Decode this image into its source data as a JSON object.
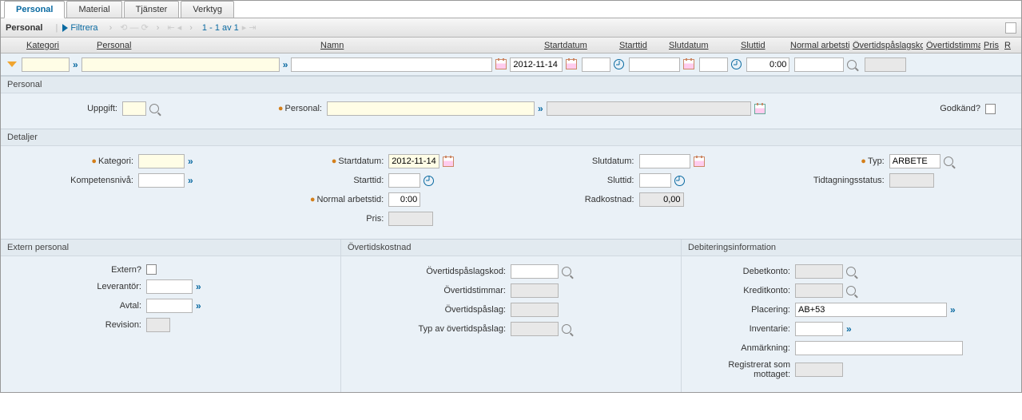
{
  "tabs": [
    "Personal",
    "Material",
    "Tjänster",
    "Verktyg"
  ],
  "toolbar": {
    "title": "Personal",
    "filter": "Filtrera",
    "paging": "1 - 1 av 1"
  },
  "columns": {
    "kategori": "Kategori",
    "personal": "Personal",
    "namn": "Namn",
    "startdatum": "Startdatum",
    "starttid": "Starttid",
    "slutdatum": "Slutdatum",
    "sluttid": "Sluttid",
    "normal": "Normal arbetstid",
    "otkod": "Övertidspåslagskod",
    "ottimmar": "Övertidstimmar",
    "pris": "Pris",
    "r": "R"
  },
  "filter": {
    "startdatum": "2012-11-14",
    "normal": "0:00"
  },
  "sections": {
    "personal": "Personal",
    "detaljer": "Detaljer",
    "extern": "Extern personal",
    "overtid": "Övertidskostnad",
    "debit": "Debiteringsinformation"
  },
  "labels": {
    "uppgift": "Uppgift:",
    "personal": "Personal:",
    "godkand": "Godkänd?",
    "kategori": "Kategori:",
    "kompetens": "Kompetensnivå:",
    "startdatum": "Startdatum:",
    "starttid": "Starttid:",
    "normal": "Normal arbetstid:",
    "pris": "Pris:",
    "slutdatum": "Slutdatum:",
    "sluttid": "Sluttid:",
    "radkostnad": "Radkostnad:",
    "typ": "Typ:",
    "tidtagning": "Tidtagningsstatus:",
    "extern": "Extern?",
    "leverantor": "Leverantör:",
    "avtal": "Avtal:",
    "revision": "Revision:",
    "otkod": "Övertidspåslagskod:",
    "ottimmar": "Övertidstimmar:",
    "otpaslag": "Övertidspåslag:",
    "ottyp": "Typ av övertidspåslag:",
    "debetkonto": "Debetkonto:",
    "kreditkonto": "Kreditkonto:",
    "placering": "Placering:",
    "inventarie": "Inventarie:",
    "anmarkning": "Anmärkning:",
    "registrerat": "Registrerat som mottaget:"
  },
  "values": {
    "startdatum": "2012-11-14",
    "normal": "0:00",
    "radkostnad": "0,00",
    "typ": "ARBETE",
    "placering": "AB+53"
  }
}
